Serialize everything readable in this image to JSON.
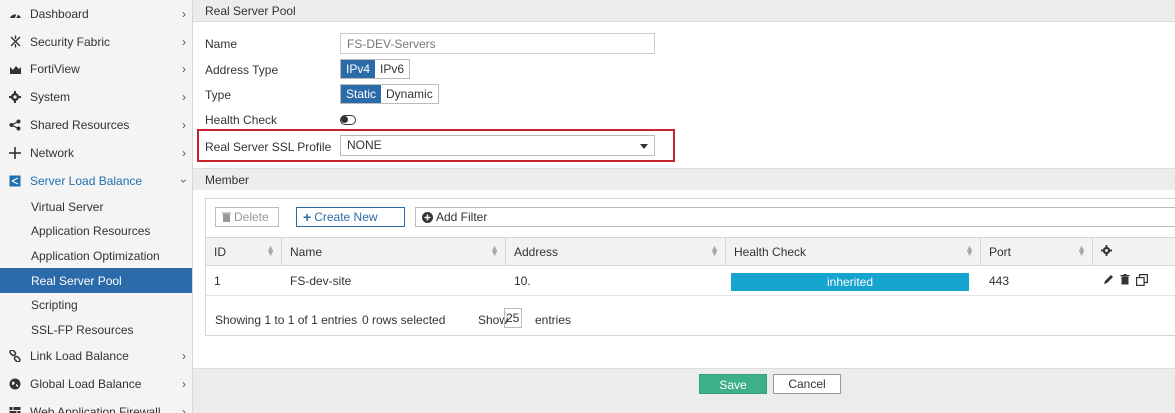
{
  "sidebar": {
    "items": [
      {
        "label": "Dashboard",
        "icon": "dashboard-icon"
      },
      {
        "label": "Security Fabric",
        "icon": "security-fabric-icon"
      },
      {
        "label": "FortiView",
        "icon": "fortiview-icon"
      },
      {
        "label": "System",
        "icon": "gear-icon"
      },
      {
        "label": "Shared Resources",
        "icon": "share-icon"
      },
      {
        "label": "Network",
        "icon": "network-icon"
      },
      {
        "label": "Server Load Balance",
        "icon": "load-balance-icon"
      }
    ],
    "subitems": [
      {
        "label": "Virtual Server"
      },
      {
        "label": "Application Resources"
      },
      {
        "label": "Application Optimization"
      },
      {
        "label": "Real Server Pool"
      },
      {
        "label": "Scripting"
      },
      {
        "label": "SSL-FP Resources"
      }
    ],
    "bottom_items": [
      {
        "label": "Link Load Balance",
        "icon": "link-icon"
      },
      {
        "label": "Global Load Balance",
        "icon": "globe-icon"
      },
      {
        "label": "Web Application Firewall",
        "icon": "firewall-icon"
      }
    ],
    "active_subitem": "Real Server Pool",
    "accent": "#2c6ba9"
  },
  "form": {
    "title": "Real Server Pool",
    "name_label": "Name",
    "name_value": "FS-DEV-Servers",
    "address_type_label": "Address Type",
    "address_type_options": [
      "IPv4",
      "IPv6"
    ],
    "address_type_selected": "IPv4",
    "type_label": "Type",
    "type_options": [
      "Static",
      "Dynamic"
    ],
    "type_selected": "Static",
    "health_check_label": "Health Check",
    "health_check_enabled": false,
    "ssl_profile_label": "Real Server SSL Profile",
    "ssl_profile_value": "NONE"
  },
  "member": {
    "title": "Member",
    "delete_label": "Delete",
    "create_label": "Create New",
    "filter_label": "Add Filter",
    "columns": [
      "ID",
      "Name",
      "Address",
      "Health Check",
      "Port"
    ],
    "rows": [
      {
        "id": "1",
        "name": "FS-dev-site",
        "address": "10.",
        "health_check": "inherited",
        "port": "443"
      }
    ],
    "showing_text": "Showing 1 to 1 of 1 entries",
    "selected_text": "0 rows selected",
    "show_label": "Show",
    "show_value": "25",
    "entries_label": "entries",
    "health_color": "#15a3d0"
  },
  "actions": {
    "save_label": "Save",
    "cancel_label": "Cancel",
    "save_color": "#3db08b"
  }
}
